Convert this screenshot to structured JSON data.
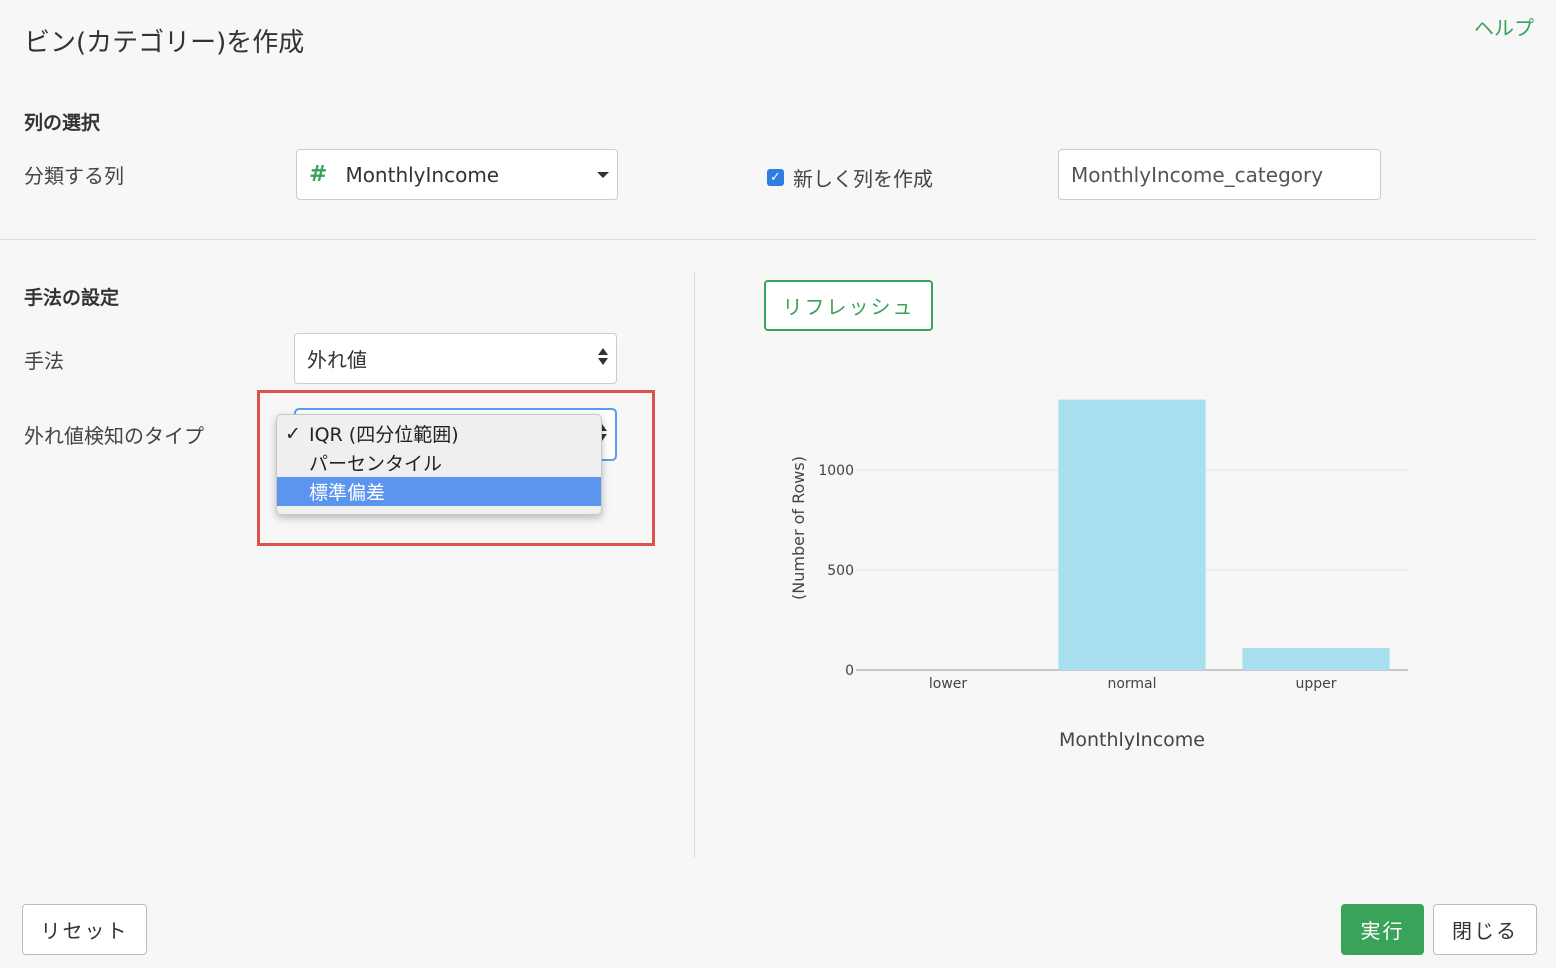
{
  "dialog": {
    "title": "ビン(カテゴリー)を作成",
    "help_label": "ヘルプ"
  },
  "column_section": {
    "heading": "列の選択",
    "classify_label": "分類する列",
    "column_type_icon": "#",
    "column_value": "MonthlyIncome",
    "new_column_checked": true,
    "new_column_label": "新しく列を作成",
    "new_column_name": "MonthlyIncome_category"
  },
  "method_section": {
    "heading": "手法の設定",
    "method_label": "手法",
    "method_value": "外れ値",
    "outlier_type_label": "外れ値検知のタイプ",
    "outlier_options": [
      {
        "label": "IQR (四分位範囲)",
        "checked": true,
        "highlighted": false
      },
      {
        "label": "パーセンタイル",
        "checked": false,
        "highlighted": false
      },
      {
        "label": "標準偏差",
        "checked": false,
        "highlighted": true
      }
    ]
  },
  "preview": {
    "refresh_label": "リフレッシュ"
  },
  "chart_data": {
    "type": "bar",
    "categories": [
      "lower",
      "normal",
      "upper"
    ],
    "values": [
      0,
      1352,
      110
    ],
    "xlabel": "MonthlyIncome",
    "ylabel": "(Number of Rows)",
    "yticks": [
      0,
      500,
      1000
    ],
    "ylim": [
      0,
      1400
    ],
    "bar_color": "#a8e0f0",
    "grid": true
  },
  "footer": {
    "reset_label": "リセット",
    "run_label": "実行",
    "close_label": "閉じる"
  },
  "colors": {
    "accent_green": "#3aa35a",
    "highlight_red": "#d9534f",
    "selection_blue": "#5b95ee"
  }
}
